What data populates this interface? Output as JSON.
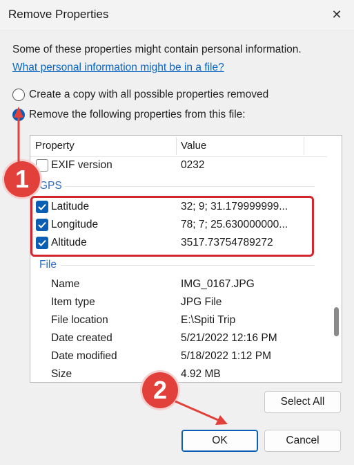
{
  "window": {
    "title": "Remove Properties",
    "close_glyph": "✕"
  },
  "intro_text": "Some of these properties might contain personal information.",
  "help_link": "What personal information might be in a file?",
  "options": [
    {
      "label": "Create a copy with all possible properties removed",
      "selected": false
    },
    {
      "label": "Remove the following properties from this file:",
      "selected": true
    }
  ],
  "list": {
    "headers": {
      "property": "Property",
      "value": "Value"
    },
    "rows": [
      {
        "name": "EXIF version",
        "value": "0232",
        "checked": false
      },
      {
        "group": "GPS"
      },
      {
        "name": "Latitude",
        "value": "32; 9; 31.179999999...",
        "checked": true
      },
      {
        "name": "Longitude",
        "value": "78; 7; 25.630000000...",
        "checked": true
      },
      {
        "name": "Altitude",
        "value": "3517.73754789272",
        "checked": true
      },
      {
        "group": "File"
      },
      {
        "name": "Name",
        "value": "IMG_0167.JPG"
      },
      {
        "name": "Item type",
        "value": "JPG File"
      },
      {
        "name": "File location",
        "value": "E:\\Spiti Trip"
      },
      {
        "name": "Date created",
        "value": "5/21/2022 12:16 PM"
      },
      {
        "name": "Date modified",
        "value": "5/18/2022 1:12 PM"
      },
      {
        "name": "Size",
        "value": "4.92 MB"
      }
    ]
  },
  "buttons": {
    "select_all": "Select All",
    "ok": "OK",
    "cancel": "Cancel"
  },
  "annotations": {
    "badge1": "1",
    "badge2": "2",
    "accent": "#e2403b"
  }
}
